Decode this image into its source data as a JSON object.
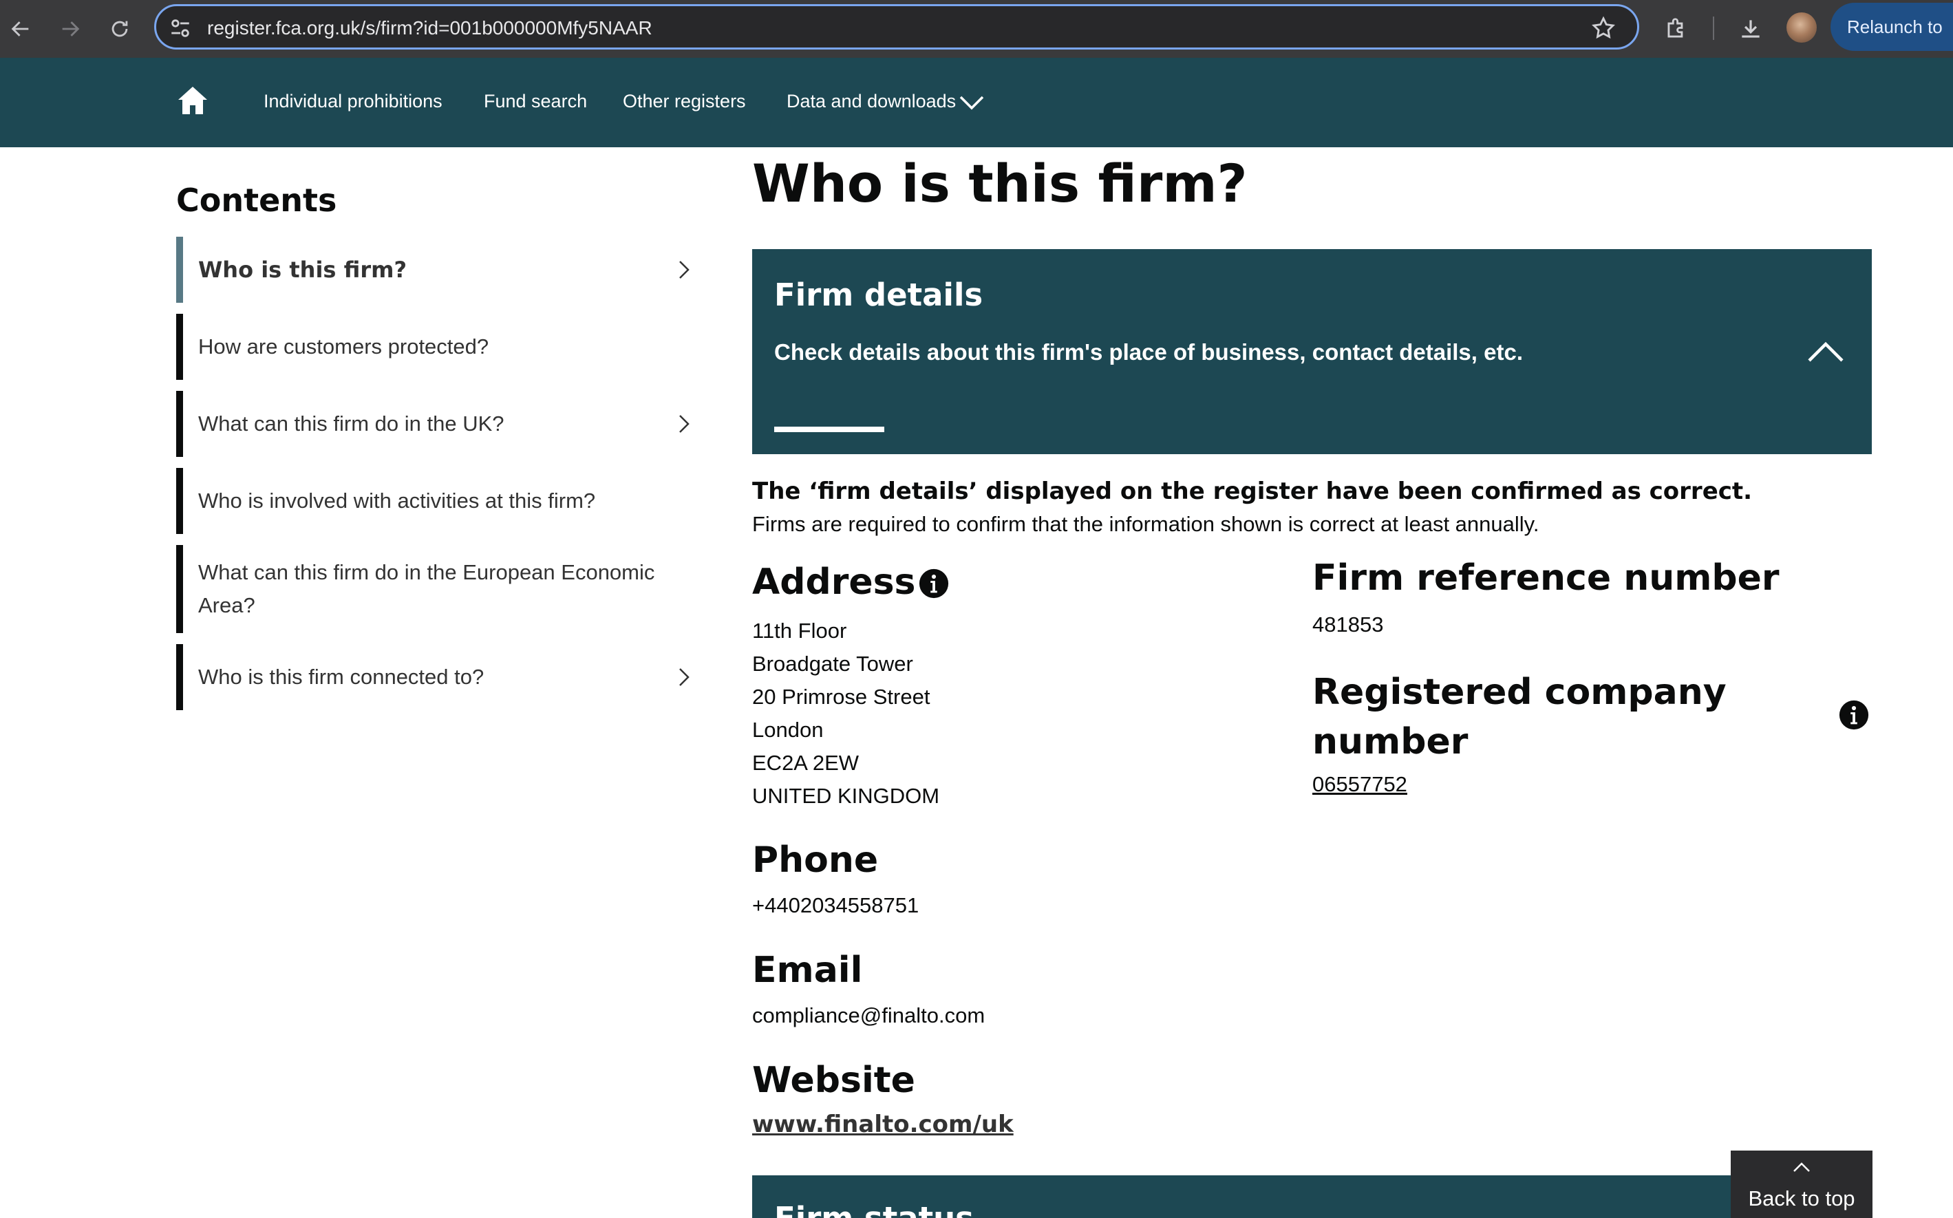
{
  "browser": {
    "url": "register.fca.org.uk/s/firm?id=001b000000Mfy5NAAR",
    "relaunch_label": "Relaunch to",
    "icons": {
      "back": "arrow-left-icon",
      "forward": "arrow-right-icon",
      "reload": "reload-icon",
      "site_info": "tune-icon",
      "bookmark": "star-icon",
      "extensions": "puzzle-icon",
      "downloads": "download-icon",
      "profile": "avatar"
    },
    "colors": {
      "frame": "#3a3a3c",
      "url_border": "#7aa6ef",
      "relaunch_bg": "#1f4f86"
    }
  },
  "site_nav": {
    "home_icon": "home-icon",
    "items": [
      {
        "label": "Individual prohibitions"
      },
      {
        "label": "Fund search"
      },
      {
        "label": "Other registers"
      },
      {
        "label": "Data and downloads"
      }
    ],
    "colors": {
      "background": "#1d4853"
    }
  },
  "sidebar": {
    "title": "Contents",
    "items": [
      {
        "label": "Who is this firm?",
        "active": true,
        "has_chevron": true
      },
      {
        "label": "How are customers protected?",
        "active": false,
        "has_chevron": false
      },
      {
        "label": "What can this firm do in the UK?",
        "active": false,
        "has_chevron": true
      },
      {
        "label": "Who is involved with activities at this firm?",
        "active": false,
        "has_chevron": false
      },
      {
        "label": "What can this firm do in the European Economic Area?",
        "active": false,
        "has_chevron": false
      },
      {
        "label": "Who is this firm connected to?",
        "active": false,
        "has_chevron": true
      }
    ],
    "colors": {
      "active_bar": "#587985",
      "bar": "#0b0c0c"
    }
  },
  "main": {
    "title": "Who is this firm?",
    "firm_details_panel": {
      "title": "Firm details",
      "description": "Check details about this firm's place of business, contact details, etc.",
      "toggle_icon": "chevron-up-icon"
    },
    "confirmation": {
      "strong": "The ‘firm details’ displayed on the register have been confirmed as correct.",
      "note": "Firms are required to confirm that the information shown is correct at least annually."
    },
    "address": {
      "heading": "Address",
      "info_icon": "info-icon",
      "lines": [
        "11th Floor",
        "Broadgate Tower",
        "20 Primrose Street",
        "London",
        "EC2A 2EW",
        "UNITED KINGDOM"
      ]
    },
    "phone": {
      "heading": "Phone",
      "value": "+4402034558751"
    },
    "email": {
      "heading": "Email",
      "value": "compliance@finalto.com"
    },
    "website": {
      "heading": "Website",
      "value": "www.finalto.com/uk"
    },
    "firm_reference": {
      "heading": "Firm reference number",
      "value": "481853"
    },
    "company_number": {
      "heading": "Registered company number",
      "value": "06557752",
      "info_icon": "info-icon"
    },
    "firm_status_panel": {
      "title": "Firm status"
    },
    "back_to_top": {
      "label": "Back to top",
      "icon": "chevron-up-icon"
    }
  }
}
